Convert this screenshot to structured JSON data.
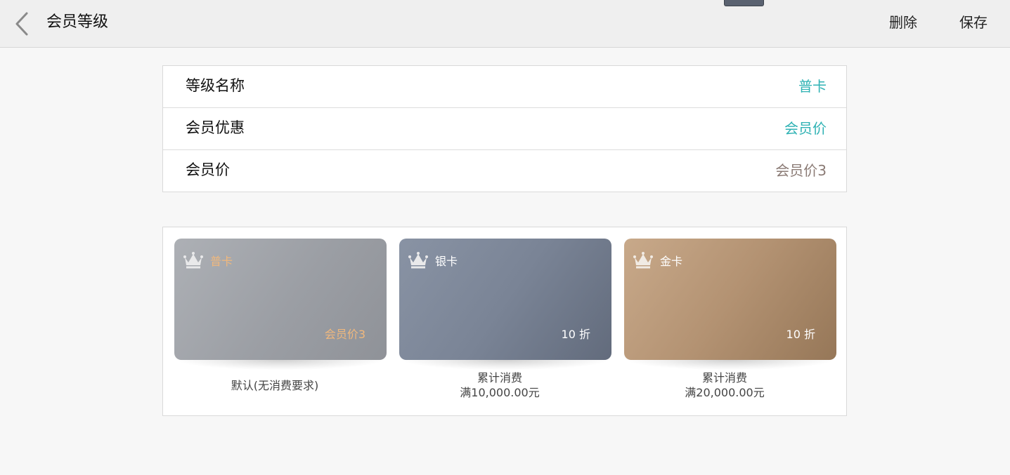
{
  "header": {
    "title": "会员等级",
    "delete_label": "删除",
    "save_label": "保存"
  },
  "form": {
    "rows": [
      {
        "label": "等级名称",
        "value": "普卡"
      },
      {
        "label": "会员优惠",
        "value": "会员价"
      },
      {
        "label": "会员价",
        "value": "会员价3"
      }
    ]
  },
  "cards": [
    {
      "name": "普卡",
      "discount": "会员价3",
      "caption_line1": "默认(无消费要求)",
      "caption_line2": ""
    },
    {
      "name": "银卡",
      "discount": "10 折",
      "caption_line1": "累计消费",
      "caption_line2": "满10,000.00元"
    },
    {
      "name": "金卡",
      "discount": "10 折",
      "caption_line1": "累计消费",
      "caption_line2": "满20,000.00元"
    }
  ],
  "colors": {
    "accent_teal": "#2fb2b4",
    "value_brown": "#8a7a74",
    "card_text_orange": "#f1b87c"
  },
  "icons": {
    "back": "chevron-left-icon",
    "crown": "crown-icon"
  }
}
